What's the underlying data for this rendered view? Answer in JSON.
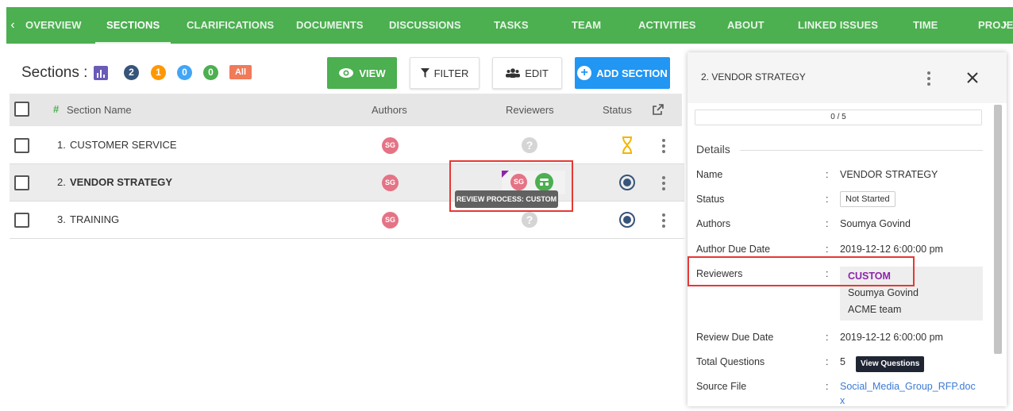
{
  "nav": {
    "tabs": [
      "OVERVIEW",
      "SECTIONS",
      "CLARIFICATIONS",
      "DOCUMENTS",
      "DISCUSSIONS",
      "TASKS",
      "TEAM",
      "ACTIVITIES",
      "ABOUT",
      "LINKED ISSUES",
      "TIME",
      "PROJEC"
    ],
    "active": "SECTIONS"
  },
  "sections_header": {
    "title": "Sections :",
    "counts": [
      "2",
      "1",
      "0",
      "0"
    ],
    "count_colors": [
      "#37547a",
      "#ff9800",
      "#42a5f5",
      "#4caf50"
    ],
    "all_label": "All"
  },
  "toolbar": {
    "view_label": "VIEW",
    "filter_label": "FILTER",
    "edit_label": "EDIT",
    "add_label": "ADD SECTION"
  },
  "table": {
    "headers": {
      "section_name": "Section Name",
      "authors": "Authors",
      "reviewers": "Reviewers",
      "status": "Status"
    },
    "rows": [
      {
        "number": "1.",
        "name": "CUSTOMER SERVICE",
        "author": "SG",
        "reviewer": "?",
        "status_icon": "hourglass-icon"
      },
      {
        "number": "2.",
        "name": "VENDOR STRATEGY",
        "author": "SG",
        "reviewer": "SG",
        "status_icon": "radio-icon"
      },
      {
        "number": "3.",
        "name": "TRAINING",
        "author": "SG",
        "reviewer": "?",
        "status_icon": "radio-icon"
      }
    ],
    "tooltip": "REVIEW PROCESS: CUSTOM"
  },
  "panel": {
    "title": "2. VENDOR STRATEGY",
    "progress": "0 / 5",
    "details_label": "Details",
    "fields": {
      "name_key": "Name",
      "name_val": "VENDOR STRATEGY",
      "status_key": "Status",
      "status_val": "Not Started",
      "authors_key": "Authors",
      "authors_val": "Soumya Govind",
      "author_due_key": "Author Due Date",
      "author_due_val": "2019-12-12 6:00:00 pm",
      "reviewers_key": "Reviewers",
      "reviewers_custom": "CUSTOM",
      "reviewers_1": "Soumya Govind",
      "reviewers_2": "ACME team",
      "review_due_key": "Review Due Date",
      "review_due_val": "2019-12-12 6:00:00 pm",
      "total_q_key": "Total Questions",
      "total_q_val": "5",
      "view_questions": "View Questions",
      "source_key": "Source File",
      "source_val": "Social_Media_Group_RFP.doc",
      "source_val_2": "x"
    }
  },
  "colors": {
    "nav_green": "#4caf50",
    "primary_blue": "#2196f3",
    "custom_purple": "#8e24aa",
    "highlight_red": "#e53935"
  }
}
